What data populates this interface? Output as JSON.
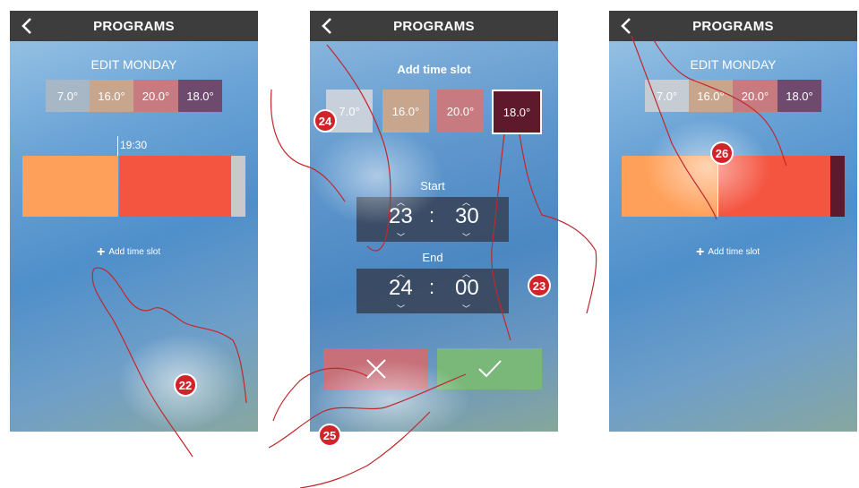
{
  "screen1": {
    "title": "PROGRAMS",
    "subtitle": "EDIT MONDAY",
    "temps": [
      "7.0°",
      "16.0°",
      "20.0°",
      "18.0°"
    ],
    "marker_time": "19:30",
    "add_slot": "Add time slot",
    "callout": "22"
  },
  "screen2": {
    "title": "PROGRAMS",
    "subtitle": "Add time slot",
    "temps": [
      "7.0°",
      "16.0°",
      "20.0°",
      "18.0°"
    ],
    "start_label": "Start",
    "start_hour": "23",
    "start_min": "30",
    "end_label": "End",
    "end_hour": "24",
    "end_min": "00",
    "colon": ":",
    "callouts": [
      "24",
      "23",
      "25"
    ]
  },
  "screen3": {
    "title": "PROGRAMS",
    "subtitle": "EDIT MONDAY",
    "temps": [
      "7.0°",
      "16.0°",
      "20.0°",
      "18.0°"
    ],
    "add_slot": "Add time slot",
    "callout": "26"
  },
  "colors": {
    "topbar": "#3d3d3d",
    "temp_7": "#a7b7c6",
    "temp_16": "#c8a58d",
    "temp_20": "#c77a80",
    "temp_18": "#5e1a2c",
    "slot_orange": "#ffa05a",
    "slot_red": "#f45540",
    "callout": "#d0232a",
    "confirm": "#7ab87a",
    "cancel": "#c7707a"
  }
}
